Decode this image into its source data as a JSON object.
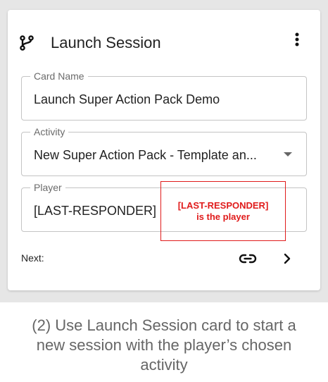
{
  "card": {
    "title": "Launch Session",
    "icons": {
      "header": "branch-icon",
      "menu": "more-vert-icon",
      "link": "link-icon",
      "next": "chevron-right-icon"
    },
    "fields": [
      {
        "label": "Card Name",
        "value": "Launch Super Action Pack Demo"
      },
      {
        "label": "Activity",
        "value": "New Super Action Pack - Template an..."
      },
      {
        "label": "Player",
        "value": "[LAST-RESPONDER]"
      }
    ],
    "next_label": "Next:"
  },
  "annotation": {
    "line1": "[LAST-RESPONDER]",
    "line2": "is the player",
    "color": "#e01b1b"
  },
  "caption": {
    "line1": "(2) Use Launch Session card to start a",
    "line2": "new session with the player’s chosen",
    "line3": "activity"
  }
}
